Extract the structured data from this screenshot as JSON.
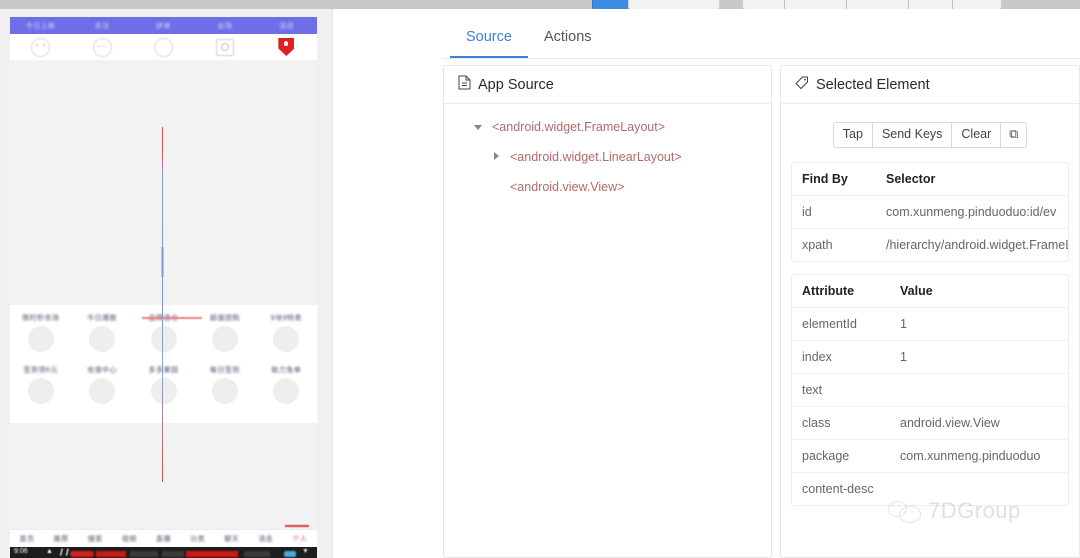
{
  "window": {
    "top_toolbar_cutoff": true
  },
  "device_screenshot": {
    "app_topbar_labels": [
      "今日上新",
      "关注",
      "拼单",
      "会场",
      "活动"
    ],
    "app_topbar_icons": [
      "face-circle-icon",
      "dots-circle-icon",
      "circle-outline-icon",
      "gear-square-icon",
      "red-shield-icon"
    ],
    "category_grid_row1": [
      "限时秒杀场",
      "今日爆款",
      "品牌清仓",
      "超值团购",
      "9块9特卖"
    ],
    "category_grid_row2": [
      "签到领6元",
      "充值中心",
      "多多果园",
      "每日签到",
      "助力免单"
    ],
    "bottom_tabs": [
      "首页",
      "推荐",
      "搜索",
      "视频",
      "直播",
      "分类",
      "聊天",
      "消息",
      "个人"
    ],
    "bottom_tab_selected": "个人",
    "status_bar_time": "9:06"
  },
  "inspector": {
    "tabs": [
      {
        "label": "Source",
        "active": true
      },
      {
        "label": "Actions",
        "active": false
      }
    ],
    "source_panel": {
      "title": "App Source",
      "icon": "file-icon",
      "tree": [
        {
          "label": "<android.widget.FrameLayout>",
          "twisty": "down",
          "depth": 0
        },
        {
          "label": "<android.widget.LinearLayout>",
          "twisty": "right",
          "depth": 1
        },
        {
          "label": "<android.view.View>",
          "twisty": "none",
          "depth": 2
        }
      ]
    },
    "element_panel": {
      "title": "Selected Element",
      "icon": "tag-icon",
      "actions": [
        {
          "label": "Tap",
          "name": "tap-button"
        },
        {
          "label": "Send Keys",
          "name": "send-keys-button"
        },
        {
          "label": "Clear",
          "name": "clear-button"
        },
        {
          "label": "⧉",
          "name": "copy-icon-button"
        }
      ],
      "selector_table": {
        "headers": [
          "Find By",
          "Selector"
        ],
        "rows": [
          {
            "find_by": "id",
            "selector": "com.xunmeng.pinduoduo:id/ev"
          },
          {
            "find_by": "xpath",
            "selector": "/hierarchy/android.widget.FrameLayout/an"
          }
        ]
      },
      "attribute_table": {
        "headers": [
          "Attribute",
          "Value"
        ],
        "rows": [
          {
            "attribute": "elementId",
            "value": "1"
          },
          {
            "attribute": "index",
            "value": "1"
          },
          {
            "attribute": "text",
            "value": ""
          },
          {
            "attribute": "class",
            "value": "android.view.View"
          },
          {
            "attribute": "package",
            "value": "com.xunmeng.pinduoduo"
          },
          {
            "attribute": "content-desc",
            "value": ""
          }
        ]
      }
    }
  },
  "watermark": {
    "text": "7DGroup",
    "logo": "wechat-bubbles-icon"
  },
  "colors": {
    "accent_blue": "#3b82d8",
    "app_purple": "#6e6ee8",
    "highlight_red": "#e05050",
    "highlight_blue": "#7f93d2",
    "tree_text": "#b46a6a"
  }
}
